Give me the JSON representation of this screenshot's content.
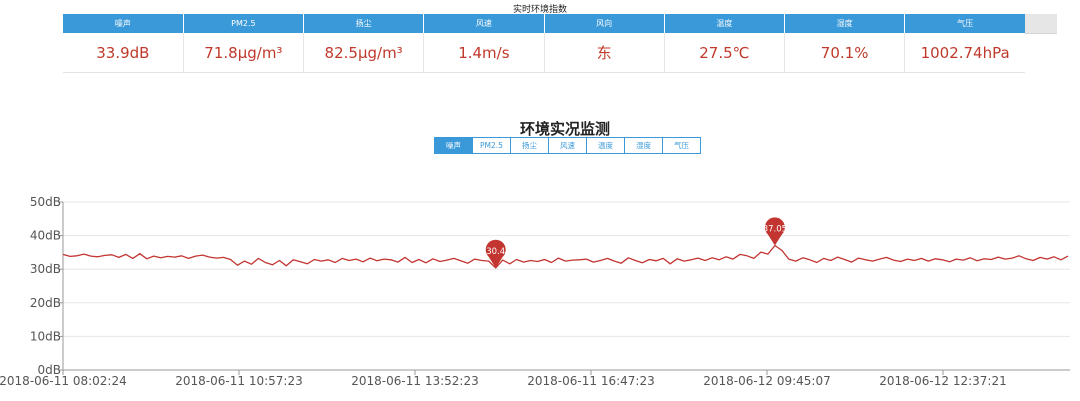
{
  "table": {
    "title": "实时环境指数",
    "headers": [
      "噪声",
      "PM2.5",
      "扬尘",
      "风速",
      "风向",
      "温度",
      "湿度",
      "气压"
    ],
    "values": [
      "33.9dB",
      "71.8μg/m³",
      "82.5μg/m³",
      "1.4m/s",
      "东",
      "27.5℃",
      "70.1%",
      "1002.74hPa"
    ]
  },
  "chart_title": "环境实况监测",
  "tabs": [
    {
      "label": "噪声",
      "active": true
    },
    {
      "label": "PM2.5",
      "active": false
    },
    {
      "label": "扬尘",
      "active": false
    },
    {
      "label": "风速",
      "active": false
    },
    {
      "label": "温度",
      "active": false
    },
    {
      "label": "湿度",
      "active": false
    },
    {
      "label": "气压",
      "active": false
    }
  ],
  "colors": {
    "accent": "#3a99d8",
    "value_text": "#c0392b",
    "line": "#c23531",
    "grid": "#e6e6e6"
  },
  "chart_data": {
    "type": "line",
    "ylim": [
      0,
      50
    ],
    "yticks": [
      "0dB",
      "10dB",
      "20dB",
      "30dB",
      "40dB",
      "50dB"
    ],
    "x_tick_labels": [
      "2018-06-11 08:02:24",
      "2018-06-11 10:57:23",
      "2018-06-11 13:52:23",
      "2018-06-11 16:47:23",
      "2018-06-12 09:45:07",
      "2018-06-12 12:37:21"
    ],
    "series": [
      {
        "values": [
          34.4,
          33.8,
          34.0,
          34.5,
          33.9,
          33.7,
          34.1,
          34.3,
          33.5,
          34.4,
          33.2,
          34.6,
          33.1,
          33.9,
          33.4,
          33.8,
          33.6,
          34.0,
          33.2,
          33.9,
          34.2,
          33.6,
          33.3,
          33.5,
          32.9,
          31.2,
          32.4,
          31.5,
          33.2,
          32.0,
          31.3,
          32.6,
          31.0,
          32.8,
          32.2,
          31.6,
          32.9,
          32.4,
          32.8,
          32.0,
          33.2,
          32.6,
          33.0,
          32.2,
          33.3,
          32.5,
          33.0,
          32.8,
          32.1,
          33.5,
          32.0,
          32.9,
          31.9,
          33.1,
          32.3,
          32.7,
          33.2,
          32.5,
          31.8,
          33.0,
          32.6,
          32.4,
          30.4,
          32.7,
          31.6,
          32.9,
          32.1,
          32.6,
          32.3,
          32.9,
          32.0,
          33.3,
          32.4,
          32.7,
          32.8,
          33.0,
          32.1,
          32.6,
          33.2,
          32.4,
          31.8,
          33.4,
          32.6,
          31.9,
          32.9,
          32.5,
          33.2,
          31.6,
          33.1,
          32.4,
          32.8,
          33.3,
          32.6,
          33.4,
          32.8,
          33.7,
          33.0,
          34.4,
          34.0,
          33.2,
          35.1,
          34.5,
          37.05,
          35.6,
          33.0,
          32.4,
          33.4,
          32.8,
          32.0,
          33.2,
          32.6,
          33.6,
          32.9,
          32.1,
          33.3,
          32.8,
          32.4,
          33.0,
          33.5,
          32.7,
          32.3,
          33.0,
          32.6,
          33.2,
          32.4,
          33.1,
          32.8,
          32.2,
          33.0,
          32.7,
          33.4,
          32.5,
          33.1,
          32.9,
          33.6,
          33.0,
          33.3,
          34.0,
          33.1,
          32.6,
          33.5,
          33.0,
          33.7,
          32.8,
          33.9
        ]
      }
    ],
    "markers": [
      {
        "label": "30.4",
        "value": 30.4
      },
      {
        "label": "37.05",
        "value": 37.05
      }
    ]
  }
}
